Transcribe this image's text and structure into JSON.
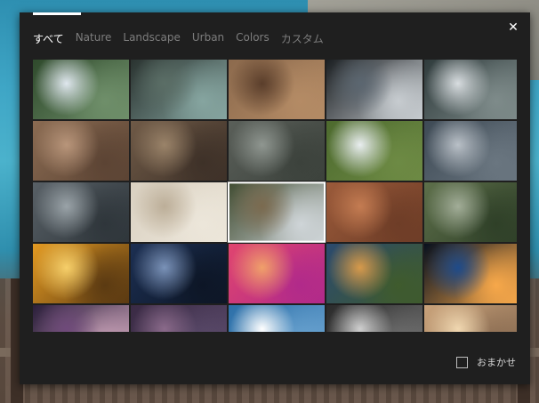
{
  "tabs": [
    {
      "label": "すべて",
      "active": true
    },
    {
      "label": "Nature",
      "active": false
    },
    {
      "label": "Landscape",
      "active": false
    },
    {
      "label": "Urban",
      "active": false
    },
    {
      "label": "Colors",
      "active": false
    },
    {
      "label": "カスタム",
      "active": false
    }
  ],
  "close_symbol": "✕",
  "footer": {
    "checkbox_label": "おまかせ",
    "checked": false
  },
  "thumbnails": [
    {
      "name": "thumb-snow-volcano",
      "colors": [
        "#2f4a2c",
        "#dfe7ee",
        "#6f8f6a"
      ]
    },
    {
      "name": "thumb-dark-coast",
      "colors": [
        "#2a3330",
        "#5b6e66",
        "#86a5a0"
      ]
    },
    {
      "name": "thumb-canyon-river",
      "colors": [
        "#8c6a4d",
        "#5a3e2b",
        "#b48b65"
      ]
    },
    {
      "name": "thumb-dark-shoreline",
      "colors": [
        "#1b1f22",
        "#5b6670",
        "#c7ccd0"
      ]
    },
    {
      "name": "thumb-snowy-ridges",
      "colors": [
        "#2f3b3c",
        "#d8dde0",
        "#7e8b8a"
      ]
    },
    {
      "name": "thumb-desert-valleys",
      "colors": [
        "#8a6b52",
        "#b8957a",
        "#5c4434"
      ]
    },
    {
      "name": "thumb-arid-hills",
      "colors": [
        "#6f5a47",
        "#9a8369",
        "#3e3128"
      ]
    },
    {
      "name": "thumb-stadium-city",
      "colors": [
        "#5a5f59",
        "#8f9690",
        "#3c423c"
      ]
    },
    {
      "name": "thumb-green-cliffs",
      "colors": [
        "#4d6a2e",
        "#e9eef0",
        "#6d8a44"
      ]
    },
    {
      "name": "thumb-mountain-folds",
      "colors": [
        "#3e4a55",
        "#b9c0c7",
        "#6a7680"
      ]
    },
    {
      "name": "thumb-city-blocks",
      "colors": [
        "#586066",
        "#9aa3a8",
        "#2f363b"
      ]
    },
    {
      "name": "thumb-salt-flat",
      "colors": [
        "#d9d0c0",
        "#bcae98",
        "#ece6da"
      ]
    },
    {
      "name": "thumb-volcano-crater",
      "colors": [
        "#3e4a2f",
        "#7b6a4f",
        "#cfd5d8"
      ]
    },
    {
      "name": "thumb-red-plateau",
      "colors": [
        "#9a5a3a",
        "#c47c52",
        "#6e3d27"
      ]
    },
    {
      "name": "thumb-green-town",
      "colors": [
        "#5d6f4a",
        "#a2ad98",
        "#2f4028"
      ]
    },
    {
      "name": "thumb-golden-sunset",
      "colors": [
        "#e39a22",
        "#f6cf6a",
        "#5b3a12"
      ]
    },
    {
      "name": "thumb-mountain-lake",
      "colors": [
        "#1c2f52",
        "#7a92b8",
        "#0d1626"
      ]
    },
    {
      "name": "thumb-pink-bokeh",
      "colors": [
        "#e0456f",
        "#f0a06a",
        "#b12a8a"
      ]
    },
    {
      "name": "thumb-dusk-valley",
      "colors": [
        "#2b4a6e",
        "#d79a4b",
        "#3f5b2d"
      ]
    },
    {
      "name": "thumb-light-painting",
      "colors": [
        "#07101e",
        "#1f4b8a",
        "#f7a84a"
      ]
    },
    {
      "name": "thumb-purple-sky",
      "colors": [
        "#2a1e3a",
        "#6f4a7a",
        "#c9a2b8"
      ]
    },
    {
      "name": "thumb-violet-clouds",
      "colors": [
        "#3a2a44",
        "#8a6a8a",
        "#5a4a6a"
      ]
    },
    {
      "name": "thumb-snowy-range",
      "colors": [
        "#2c6fa8",
        "#ffffff",
        "#6aa3d0"
      ]
    },
    {
      "name": "thumb-mono-mountains",
      "colors": [
        "#2a2a2a",
        "#cfcfcf",
        "#707070"
      ]
    },
    {
      "name": "thumb-pastel-horizon",
      "colors": [
        "#c9a27a",
        "#f0d7b0",
        "#8a6c52"
      ]
    }
  ],
  "selected_index": 12
}
